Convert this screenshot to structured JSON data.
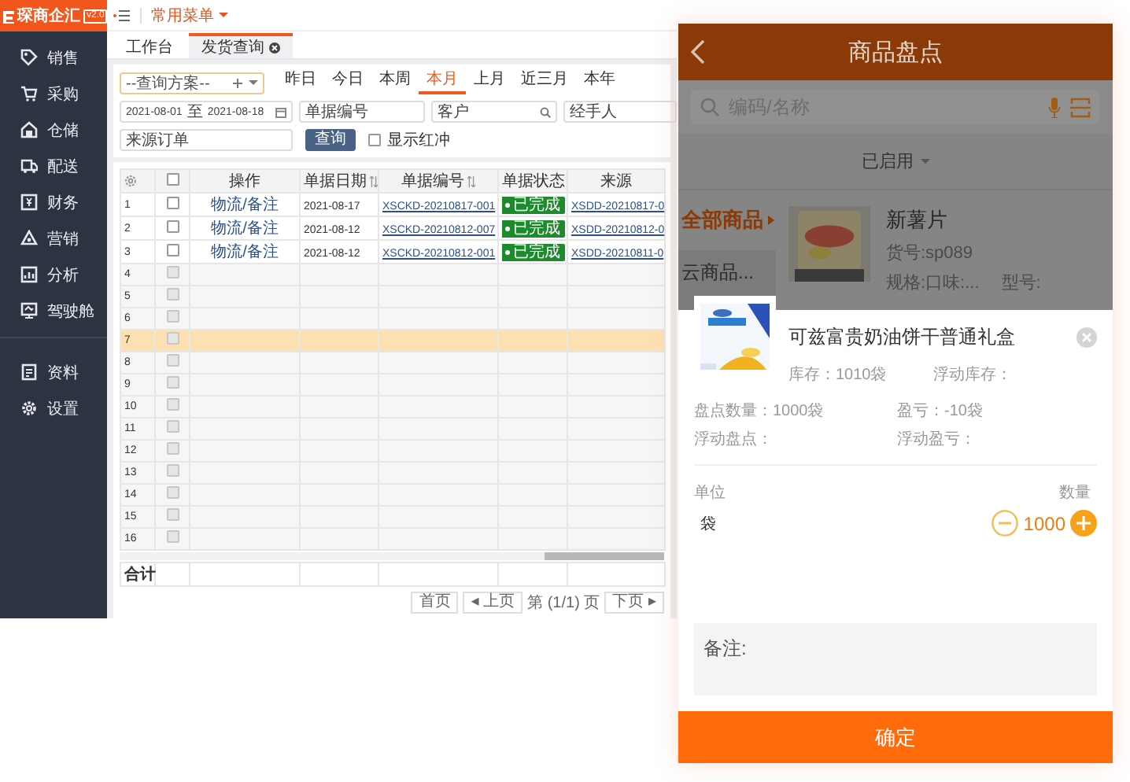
{
  "app": {
    "logo": "琛商企汇",
    "version": "v2.0",
    "quick_menu": "常用菜单"
  },
  "sidebar": {
    "groups": [
      [
        {
          "label": "销售"
        },
        {
          "label": "采购"
        },
        {
          "label": "仓储"
        },
        {
          "label": "配送"
        },
        {
          "label": "财务"
        },
        {
          "label": "营销"
        },
        {
          "label": "分析"
        },
        {
          "label": "驾驶舱"
        }
      ],
      [
        {
          "label": "资料"
        },
        {
          "label": "设置"
        }
      ]
    ]
  },
  "tabs": [
    {
      "label": "工作台",
      "selected": false,
      "closable": false
    },
    {
      "label": "发货查询",
      "selected": true,
      "closable": true
    }
  ],
  "filters": {
    "scheme": {
      "label": "--查询方案--"
    },
    "periods": [
      {
        "label": "昨日",
        "selected": false
      },
      {
        "label": "今日",
        "selected": false
      },
      {
        "label": "本周",
        "selected": false
      },
      {
        "label": "本月",
        "selected": true
      },
      {
        "label": "上月",
        "selected": false
      },
      {
        "label": "近三月",
        "selected": false
      },
      {
        "label": "本年",
        "selected": false
      }
    ],
    "date_range": {
      "start": "2021-08-01",
      "separator": "至",
      "end": "2021-08-18"
    },
    "fields": [
      {
        "placeholder": "单据编号",
        "kind": "text"
      },
      {
        "placeholder": "客户",
        "kind": "search"
      },
      {
        "placeholder": "经手人",
        "kind": "text"
      }
    ],
    "source": {
      "placeholder": "来源订单"
    },
    "search_button": "查询",
    "red_flush": {
      "label": "显示红冲",
      "checked": false
    }
  },
  "table": {
    "select_all": {
      "checked": false
    },
    "columns": [
      {
        "label": "操作",
        "sortable": false
      },
      {
        "label": "单据日期",
        "sortable": true
      },
      {
        "label": "单据编号",
        "sortable": true
      },
      {
        "label": "单据状态",
        "sortable": false
      },
      {
        "label": "来源",
        "sortable": false
      }
    ],
    "rows": [
      {
        "number": "1",
        "checked": false,
        "disabled": false,
        "selected": false,
        "action": "物流/备注",
        "date": "2021-08-17",
        "doc_no": "XSCKD-20210817-001",
        "status": "已完成",
        "source": "XSDD-20210817-0"
      },
      {
        "number": "2",
        "checked": false,
        "disabled": false,
        "selected": false,
        "action": "物流/备注",
        "date": "2021-08-12",
        "doc_no": "XSCKD-20210812-007",
        "status": "已完成",
        "source": "XSDD-20210812-0"
      },
      {
        "number": "3",
        "checked": false,
        "disabled": false,
        "selected": false,
        "action": "物流/备注",
        "date": "2021-08-12",
        "doc_no": "XSCKD-20210812-001",
        "status": "已完成",
        "source": "XSDD-20210811-0"
      },
      {
        "number": "4",
        "checked": false,
        "disabled": true,
        "selected": false
      },
      {
        "number": "5",
        "checked": false,
        "disabled": true,
        "selected": false
      },
      {
        "number": "6",
        "checked": false,
        "disabled": true,
        "selected": false
      },
      {
        "number": "7",
        "checked": false,
        "disabled": true,
        "selected": true
      },
      {
        "number": "8",
        "checked": false,
        "disabled": true,
        "selected": false
      },
      {
        "number": "9",
        "checked": false,
        "disabled": true,
        "selected": false
      },
      {
        "number": "10",
        "checked": false,
        "disabled": true,
        "selected": false
      },
      {
        "number": "11",
        "checked": false,
        "disabled": true,
        "selected": false
      },
      {
        "number": "12",
        "checked": false,
        "disabled": true,
        "selected": false
      },
      {
        "number": "13",
        "checked": false,
        "disabled": true,
        "selected": false
      },
      {
        "number": "14",
        "checked": false,
        "disabled": true,
        "selected": false
      },
      {
        "number": "15",
        "checked": false,
        "disabled": true,
        "selected": false
      },
      {
        "number": "16",
        "checked": false,
        "disabled": true,
        "selected": false
      }
    ],
    "summary_label": "合计"
  },
  "pager": {
    "first": "首页",
    "prev": "◂ 上页",
    "page": "第 (1/1) 页",
    "next": "下页 ▸"
  },
  "mobile": {
    "title": "商品盘点",
    "search": {
      "placeholder": "编码/名称"
    },
    "filter": "已启用",
    "categories": [
      {
        "label": "全部商品",
        "selected": true
      },
      {
        "label": "云商品...",
        "selected": false
      }
    ],
    "product": {
      "name": "新薯片",
      "code": "货号:sp089",
      "spec": "规格:口味:...",
      "model": "型号:"
    },
    "popup": {
      "name": "可兹富贵奶油饼干普通礼盒",
      "stock": "库存：1010袋",
      "float_stock": "浮动库存：",
      "details": [
        "盘点数量：1000袋",
        "盈亏：-10袋",
        "浮动盘点：",
        "浮动盈亏："
      ],
      "unit_header": "单位",
      "qty_header": "数量",
      "unit": "袋",
      "qty": "1000",
      "note": {
        "placeholder": "备注:"
      },
      "confirm": "确定"
    }
  }
}
